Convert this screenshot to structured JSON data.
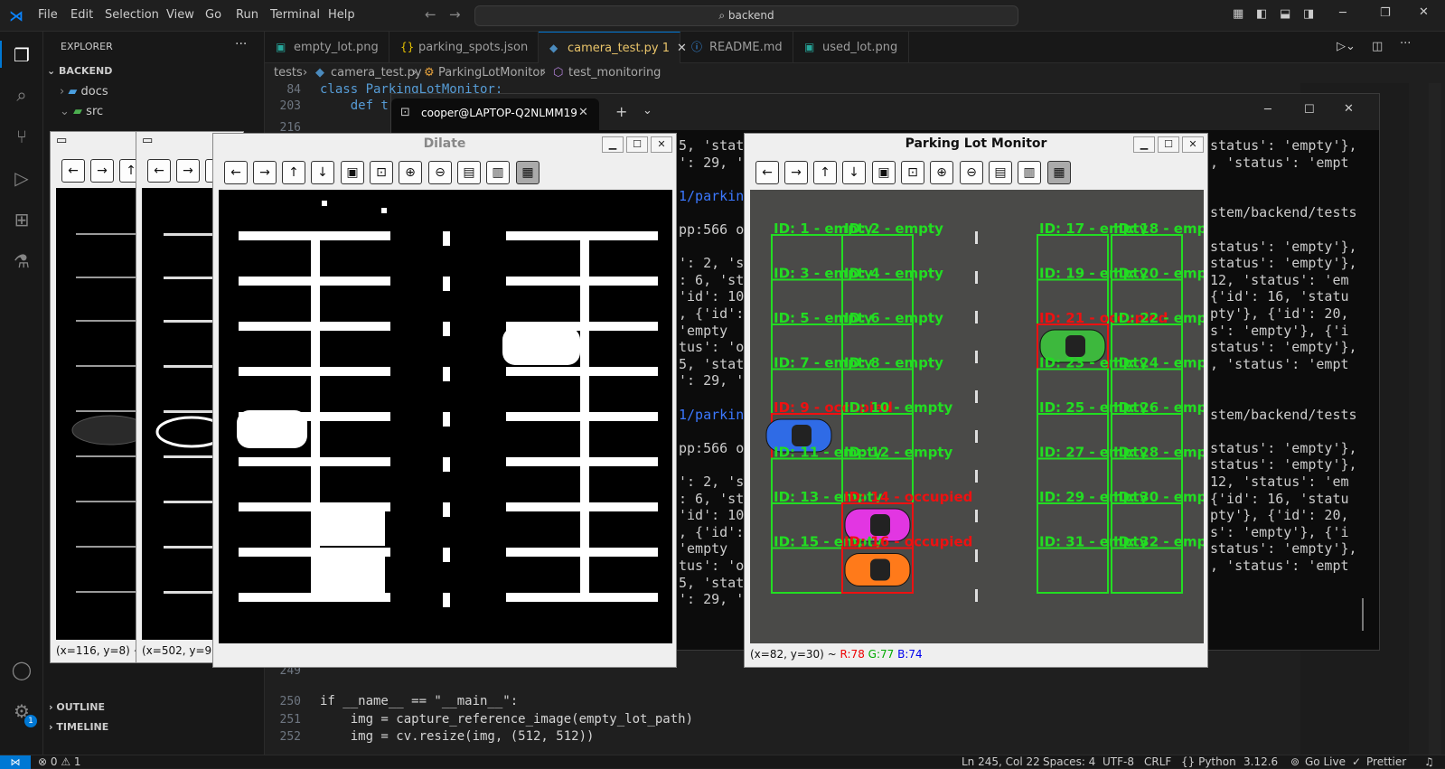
{
  "titlebar": {
    "menu": [
      "File",
      "Edit",
      "Selection",
      "View",
      "Go",
      "Run",
      "Terminal",
      "Help"
    ],
    "search": "backend"
  },
  "sidebar": {
    "header": "EXPLORER",
    "root": "BACKEND",
    "items": [
      "docs",
      "src"
    ],
    "outline": "OUTLINE",
    "timeline": "TIMELINE"
  },
  "tabs": [
    {
      "label": "empty_lot.png",
      "icon": "image-icon"
    },
    {
      "label": "parking_spots.json",
      "icon": "json-icon"
    },
    {
      "label": "camera_test.py 1",
      "icon": "python-icon"
    },
    {
      "label": "README.md",
      "icon": "info-icon"
    },
    {
      "label": "used_lot.png",
      "icon": "image-icon"
    }
  ],
  "breadcrumb": [
    "tests",
    "camera_test.py",
    "ParkingLotMonitor",
    "test_monitoring"
  ],
  "editor": {
    "top_lines": [
      {
        "num": "84",
        "code": "class ParkingLotMonitor:"
      },
      {
        "num": "203",
        "code": "    def t"
      },
      {
        "num": "216",
        "code": ""
      }
    ],
    "bottom_lines": [
      {
        "num": "249",
        "code": ""
      },
      {
        "num": "250",
        "code": "if __name__ == \"__main__\":"
      },
      {
        "num": "251",
        "code": "    img = capture_reference_image(empty_lot_path)"
      },
      {
        "num": "252",
        "code": "    img = cv.resize(img, (512, 512))"
      }
    ]
  },
  "terminal": {
    "tab_title": "cooper@LAPTOP-Q2NLMM19",
    "left_lines": [
      "5, 'statu",
      "': 29, 's",
      "",
      "1/parking",
      "",
      "pp:566 op",
      "",
      "': 2, 'sta",
      ": 6, 'sta",
      "'id': 10,",
      ", {'id':",
      "'empty",
      "tus': 'oc",
      "5, 'statu",
      "': 29, 's",
      "",
      "1/parking",
      "",
      "pp:566 op",
      "",
      "': 2, 'sta",
      ": 6, 'sta",
      "'id': 10,",
      ", {'id':",
      "'empty",
      "tus': 'oc",
      "5, 'statu",
      "': 29, 's"
    ],
    "right_lines": [
      "status': 'empty'},",
      ", 'status': 'empt",
      "",
      "",
      "stem/backend/tests",
      "",
      "status': 'empty'},",
      "status': 'empty'},",
      "12, 'status': 'em",
      "{'id': 16, 'statu",
      "pty'}, {'id': 20,",
      "s': 'empty'}, {'i",
      "status': 'empty'},",
      ", 'status': 'empt",
      "",
      "",
      "stem/backend/tests",
      "",
      "status': 'empty'},",
      "status': 'empty'},",
      "12, 'status': 'em",
      "{'id': 16, 'statu",
      "pty'}, {'id': 20,",
      "s': 'empty'}, {'i",
      "status': 'empty'},",
      ", 'status': 'empt"
    ]
  },
  "windows": {
    "win1_status": "(x=116, y=8) ~",
    "win2_status": "(x=502, y=9",
    "dilate_title": "Dilate",
    "monitor_title": "Parking Lot Monitor",
    "monitor_status_prefix": "(x=82, y=30) ~",
    "monitor_r": "R:78",
    "monitor_g": "G:77",
    "monitor_b": "B:74"
  },
  "spots": [
    {
      "label": "ID: 1 - empty",
      "status": "empty"
    },
    {
      "label": "ID: 2 - empty",
      "status": "empty"
    },
    {
      "label": "ID: 3 - empty",
      "status": "empty"
    },
    {
      "label": "ID: 4 - empty",
      "status": "empty"
    },
    {
      "label": "ID: 5 - empty",
      "status": "empty"
    },
    {
      "label": "ID: 6 - empty",
      "status": "empty"
    },
    {
      "label": "ID: 7 - empty",
      "status": "empty"
    },
    {
      "label": "ID: 8 - empty",
      "status": "empty"
    },
    {
      "label": "ID: 9 - occupied",
      "status": "occupied"
    },
    {
      "label": "ID: 10 - empty",
      "status": "empty"
    },
    {
      "label": "ID: 11 - empty",
      "status": "empty"
    },
    {
      "label": "ID: 12 - empty",
      "status": "empty"
    },
    {
      "label": "ID: 13 - empty",
      "status": "empty"
    },
    {
      "label": "ID: 14 - occupied",
      "status": "occupied"
    },
    {
      "label": "ID: 15 - empty",
      "status": "empty"
    },
    {
      "label": "ID: 16 - occupied",
      "status": "occupied"
    },
    {
      "label": "ID: 17 - empty",
      "status": "empty"
    },
    {
      "label": "ID: 18 - empty",
      "status": "empty"
    },
    {
      "label": "ID: 19 - empty",
      "status": "empty"
    },
    {
      "label": "ID: 20 - empty",
      "status": "empty"
    },
    {
      "label": "ID: 21 - occupied",
      "status": "occupied"
    },
    {
      "label": "ID: 22 - empty",
      "status": "empty"
    },
    {
      "label": "ID: 23 - empty",
      "status": "empty"
    },
    {
      "label": "ID: 24 - empty",
      "status": "empty"
    },
    {
      "label": "ID: 25 - empty",
      "status": "empty"
    },
    {
      "label": "ID: 26 - empty",
      "status": "empty"
    },
    {
      "label": "ID: 27 - empty",
      "status": "empty"
    },
    {
      "label": "ID: 28 - empty",
      "status": "empty"
    },
    {
      "label": "ID: 29 - empty",
      "status": "empty"
    },
    {
      "label": "ID: 30 - empty",
      "status": "empty"
    },
    {
      "label": "ID: 31 - empty",
      "status": "empty"
    },
    {
      "label": "ID: 32 - empty",
      "status": "empty"
    }
  ],
  "statusbar": {
    "problems": "⊗ 0 ⚠ 1",
    "position": "Ln 245, Col 22",
    "spaces": "Spaces: 4",
    "encoding": "UTF-8",
    "eol": "CRLF",
    "language": "{} Python",
    "version": "3.12.6",
    "golive": "Go Live",
    "prettier": "Prettier"
  },
  "colors": {
    "accent": "#0078d4",
    "empty": "#22dd22",
    "occupied": "#ee1111"
  }
}
